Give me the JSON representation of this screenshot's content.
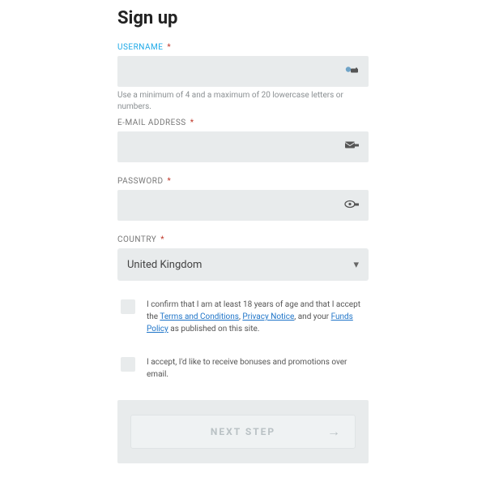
{
  "title": "Sign up",
  "labels": {
    "username": "USERNAME",
    "email": "E-MAIL ADDRESS",
    "password": "PASSWORD",
    "country": "COUNTRY"
  },
  "hints": {
    "username": "Use a minimum of 4 and a maximum of 20 lowercase letters or numbers."
  },
  "country_value": "United Kingdom",
  "checks": {
    "terms_pre": "I confirm that I am at least 18 years of age and that I accept the ",
    "terms_link": "Terms and Conditions",
    "sep1": ", ",
    "privacy_link": "Privacy Notice",
    "sep2": ", and your ",
    "funds_link": "Funds Policy",
    "terms_post": " as published on this site.",
    "promo": "I accept, I'd like to receive bonuses and promotions over email."
  },
  "button": "NEXT STEP",
  "required": "*"
}
